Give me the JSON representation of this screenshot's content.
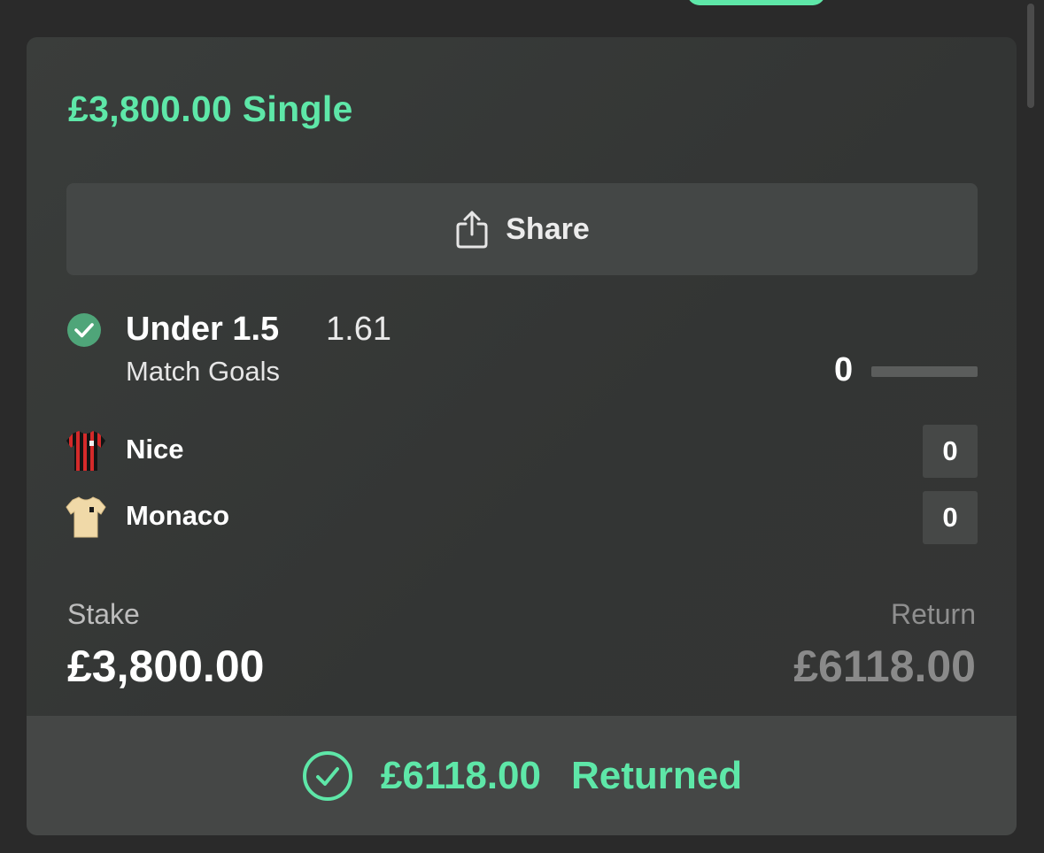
{
  "colors": {
    "accent": "#5ee7a8",
    "background": "#2a2a2a",
    "card": "#363837",
    "button": "#444746"
  },
  "bet": {
    "title": "£3,800.00 Single",
    "share_label": "Share",
    "share_icon": "share-icon"
  },
  "selection": {
    "status_icon": "check-circle-icon",
    "name": "Under 1.5",
    "odds": "1.61",
    "market": "Match Goals",
    "goals": "0"
  },
  "teams": [
    {
      "name": "Nice",
      "score": "0",
      "shirt": "red-black-striped-shirt-icon"
    },
    {
      "name": "Monaco",
      "score": "0",
      "shirt": "beige-shirt-icon"
    }
  ],
  "stake": {
    "label": "Stake",
    "value": "£3,800.00"
  },
  "return": {
    "label": "Return",
    "value": "£6118.00"
  },
  "result": {
    "icon": "check-circle-outline-icon",
    "amount": "£6118.00",
    "label": "Returned"
  }
}
